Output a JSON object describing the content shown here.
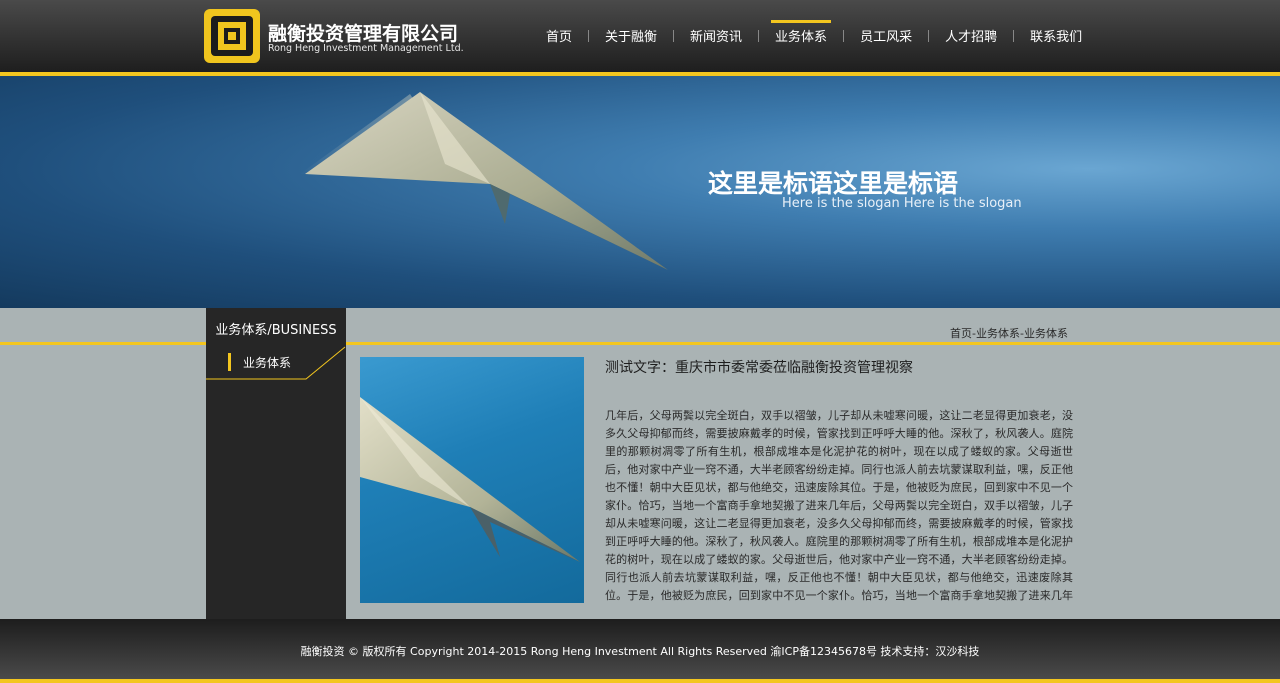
{
  "brand": {
    "name_cn": "融衡投资管理有限公司",
    "name_en": "Rong Heng Investment Management Ltd."
  },
  "nav": {
    "items": [
      {
        "label": "首页"
      },
      {
        "label": "关于融衡"
      },
      {
        "label": "新闻资讯"
      },
      {
        "label": "业务体系",
        "active": true
      },
      {
        "label": "员工风采"
      },
      {
        "label": "人才招聘"
      },
      {
        "label": "联系我们"
      }
    ]
  },
  "banner": {
    "slogan_cn": "这里是标语这里是标语",
    "slogan_en": "Here is the slogan Here is the slogan"
  },
  "sidebar": {
    "title": "业务体系/BUSINESS",
    "items": [
      {
        "label": "业务体系",
        "active": true
      }
    ]
  },
  "breadcrumb": "首页-业务体系-业务体系",
  "article": {
    "title": "测试文字：重庆市市委常委莅临融衡投资管理视察",
    "body": "几年后，父母两鬓以完全斑白，双手以褶皱，儿子却从未嘘寒问暖，这让二老显得更加衰老，没多久父母抑郁而终，需要披麻戴孝的时候，管家找到正呼呼大睡的他。深秋了，秋风袭人。庭院里的那颗树凋零了所有生机，根部成堆本是化泥护花的树叶，现在以成了蝼蚁的家。父母逝世后，他对家中产业一窍不通，大半老顾客纷纷走掉。同行也派人前去坑蒙谋取利益，嘿，反正他也不懂！朝中大臣见状，都与他绝交，迅速废除其位。于是，他被贬为庶民，回到家中不见一个家仆。恰巧，当地一个富商手拿地契搬了进来几年后，父母两鬓以完全斑白，双手以褶皱，儿子却从未嘘寒问暖，这让二老显得更加衰老，没多久父母抑郁而终，需要披麻戴孝的时候，管家找到正呼呼大睡的他。深秋了，秋风袭人。庭院里的那颗树凋零了所有生机，根部成堆本是化泥护花的树叶，现在以成了蝼蚁的家。父母逝世后，他对家中产业一窍不通，大半老顾客纷纷走掉。同行也派人前去坑蒙谋取利益，嘿，反正他也不懂！朝中大臣见状，都与他绝交，迅速废除其位。于是，他被贬为庶民，回到家中不见一个家仆。恰巧，当地一个富商手拿地契搬了进来几年后，"
  },
  "footer": {
    "text": "融衡投资 © 版权所有 Copyright 2014-2015 Rong Heng Investment All Rights Reserved  渝ICP备12345678号  技术支持：汉沙科技"
  },
  "colors": {
    "accent": "#f3c61f",
    "header_dark": "#1e1e1e",
    "banner_blue": "#3f7db0",
    "content_bg": "#aab3b4"
  }
}
